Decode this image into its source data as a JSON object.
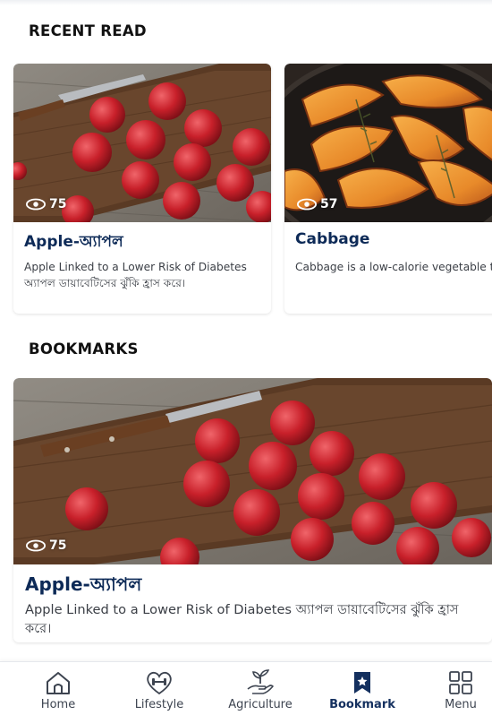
{
  "sections": {
    "recent_title": "RECENT READ",
    "bookmarks_title": "BOOKMARKS"
  },
  "recent": [
    {
      "title": "Apple-অ্যাপল",
      "views": "75",
      "description": "Apple Linked to a Lower Risk of Diabetes অ্যাপল ডায়াবেটিসের ঝুঁকি হ্রাস করে।",
      "image_icon": "apples-on-board-image"
    },
    {
      "title": "Cabbage",
      "views": "57",
      "description": "Cabbage is a low-calorie vegetable that is rich in vitamins, minerals and antioxidants.",
      "image_icon": "roasted-squash-image"
    }
  ],
  "bookmarks": [
    {
      "title": "Apple-অ্যাপল",
      "views": "75",
      "description": "Apple Linked to a Lower Risk of Diabetes অ্যাপল ডায়াবেটিসের ঝুঁকি হ্রাস করে।",
      "image_icon": "apples-on-board-image"
    }
  ],
  "nav": {
    "items": [
      {
        "label": "Home",
        "icon": "home-icon"
      },
      {
        "label": "Lifestyle",
        "icon": "heart-dumbbell-icon"
      },
      {
        "label": "Agriculture",
        "icon": "hand-plant-icon"
      },
      {
        "label": "Bookmark",
        "icon": "bookmark-star-icon"
      },
      {
        "label": "Menu",
        "icon": "grid-icon"
      }
    ],
    "active": "Bookmark"
  },
  "colors": {
    "title_navy": "#0d2a57",
    "active_navy": "#14305f",
    "apple_red": "#c8202a",
    "squash_orange": "#e88a2a"
  }
}
